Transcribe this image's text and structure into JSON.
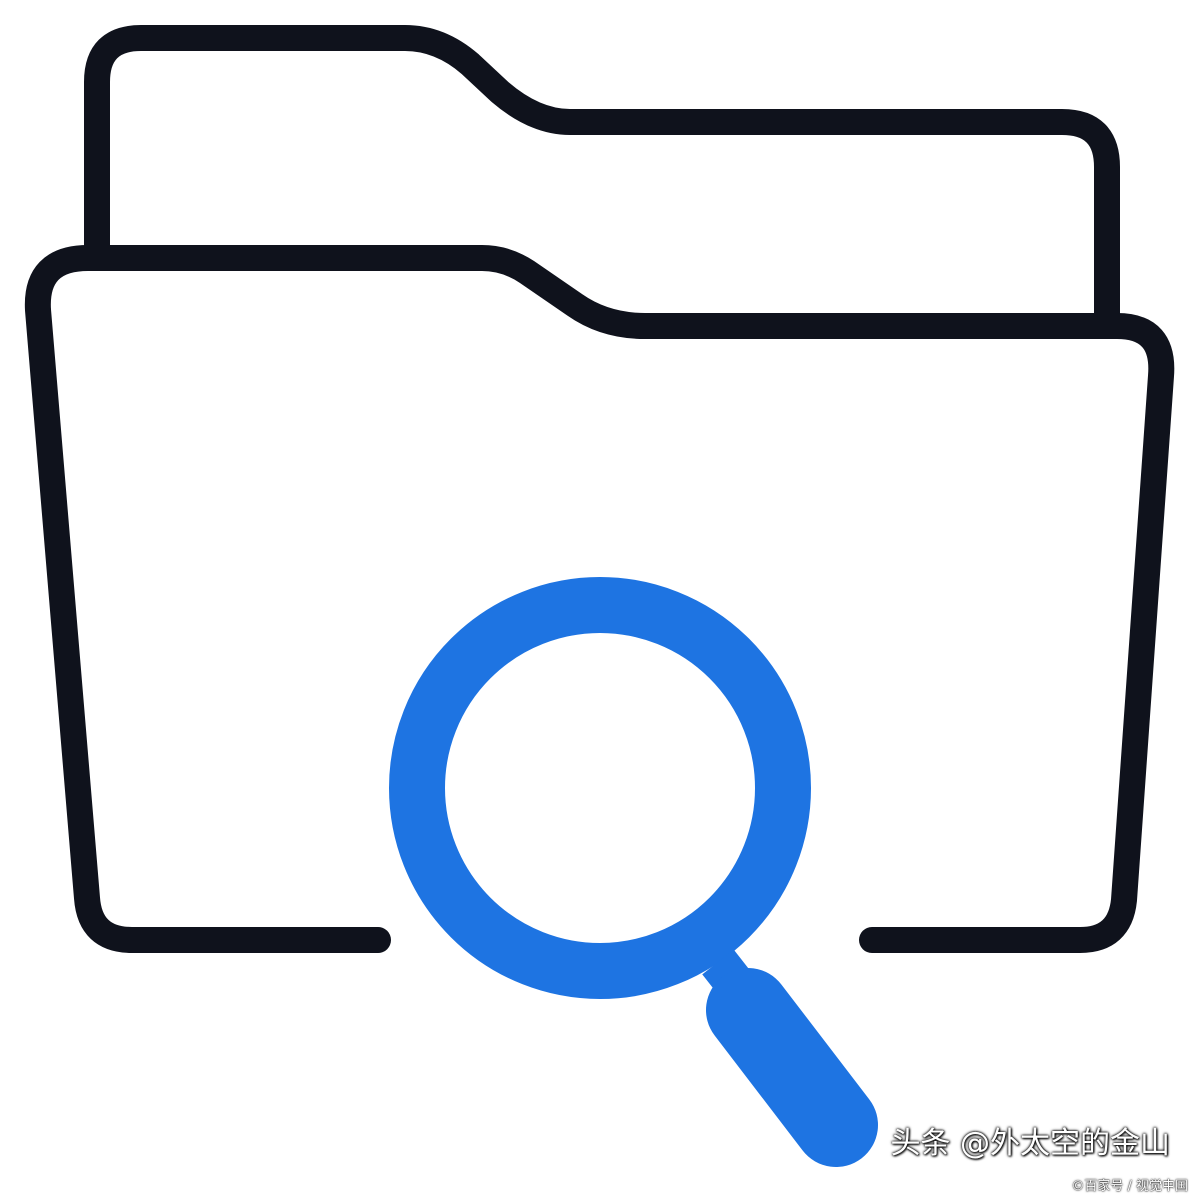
{
  "image": {
    "icon_name": "folder-search-icon",
    "colors": {
      "background": "#ffffff",
      "outline": "#0f121c",
      "accent": "#1e74e2"
    }
  },
  "watermark": {
    "main": "头条 @外太空的金山",
    "sub": "©百家号 / 视觉中国"
  }
}
